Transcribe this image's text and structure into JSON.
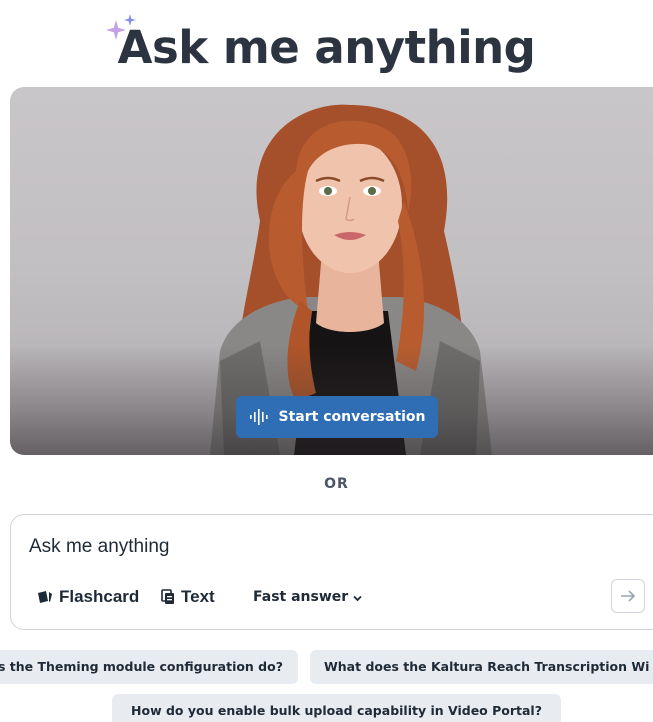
{
  "header": {
    "title": "Ask me anything",
    "sparkle_icon": "sparkle-icon"
  },
  "video": {
    "start_button_label": "Start conversation",
    "start_button_icon": "audio-wave-icon"
  },
  "separator": {
    "label": "OR"
  },
  "ask": {
    "placeholder": "Ask me anything",
    "value": "",
    "tools": {
      "flashcard_label": "Flashcard",
      "text_label": "Text",
      "speed_label": "Fast answer"
    },
    "send_icon": "arrow-right-icon"
  },
  "suggestions": [
    {
      "label": "s the Theming module configuration do?"
    },
    {
      "label": "What does the Kaltura Reach Transcription Wi"
    },
    {
      "label": "How do you enable bulk upload capability in Video Portal?"
    }
  ],
  "colors": {
    "primary_button": "#2f6db5",
    "chip_bg": "#e8ecf1",
    "title_text": "#2b3440"
  }
}
